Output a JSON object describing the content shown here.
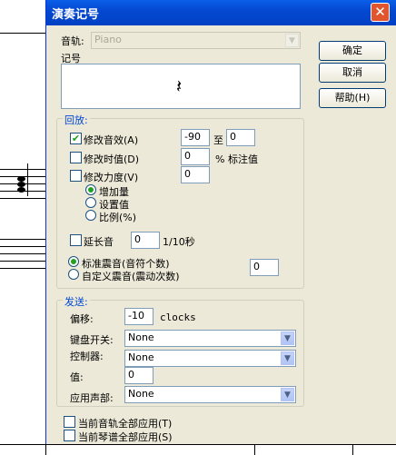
{
  "dialog": {
    "title": "演奏记号",
    "close_glyph": "✕"
  },
  "track": {
    "label": "音轨:",
    "value": "Piano"
  },
  "notation": {
    "label": "记号",
    "symbol": "𝄽"
  },
  "buttons": {
    "ok": "确定",
    "cancel": "取消",
    "help": "帮助(H)"
  },
  "playback": {
    "group_title": "回放:",
    "modify_velocity": {
      "label": "修改音效(A)",
      "checked": true,
      "from": "-90",
      "to_label": "至",
      "to": "0"
    },
    "modify_duration": {
      "label": "修改时值(D)",
      "checked": false,
      "value": "0",
      "unit": "% 标注值"
    },
    "modify_strength": {
      "label": "修改力度(V)",
      "checked": false,
      "value": "0"
    },
    "strength_modes": [
      {
        "label": "增加量",
        "selected": true
      },
      {
        "label": "设置值",
        "selected": false
      },
      {
        "label": "比例(%)",
        "selected": false
      }
    ],
    "delay": {
      "label": "延长音",
      "checked": false,
      "value": "0",
      "unit": "1/10秒"
    },
    "tremolo_modes": [
      {
        "label": "标准震音(音符个数)",
        "selected": true
      },
      {
        "label": "自定义震音(震动次数)",
        "selected": false
      }
    ],
    "tremolo_value": "0"
  },
  "send": {
    "group_title": "发送:",
    "offset": {
      "label": "偏移:",
      "value": "-10",
      "unit": "clocks"
    },
    "keyswitch": {
      "label": "键盘开关:",
      "value": "None"
    },
    "controller": {
      "label": "控制器:",
      "value": "None"
    },
    "value": {
      "label": "值:",
      "value": "0"
    },
    "apply_part": {
      "label": "应用声部:",
      "value": "None"
    }
  },
  "apply": {
    "current_track": {
      "label": "当前音轨全部应用(T)",
      "checked": false
    },
    "current_score": {
      "label": "当前琴谱全部应用(S)",
      "checked": false
    }
  }
}
